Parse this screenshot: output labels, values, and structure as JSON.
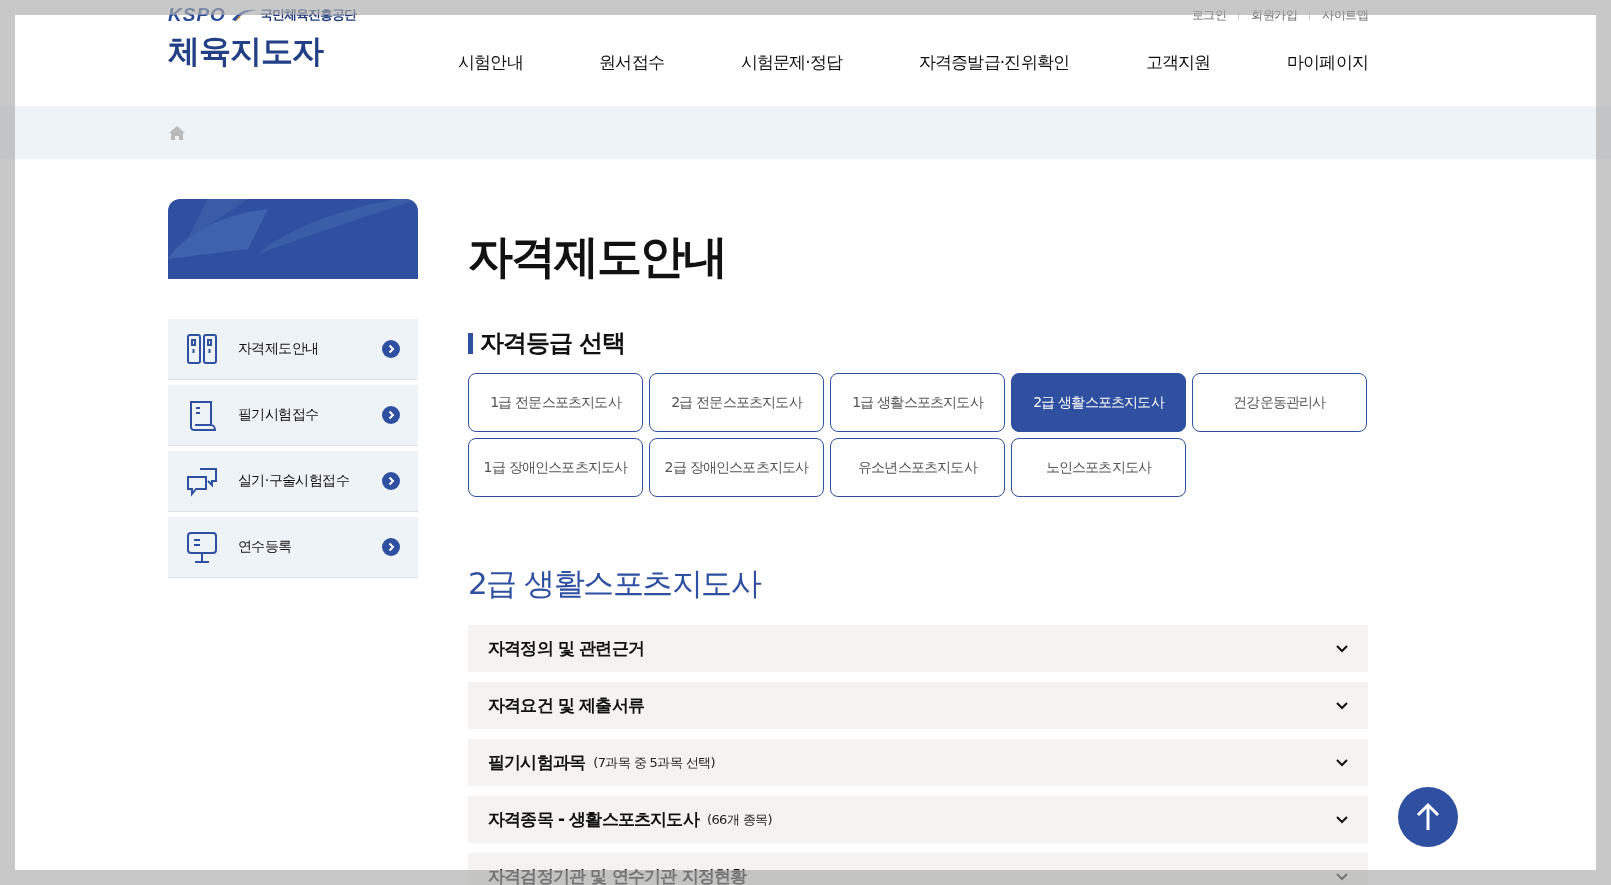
{
  "logo": {
    "org": "국민체육진흥공단",
    "mark": "KSPO",
    "title": "체육지도자"
  },
  "util_links": [
    "로그인",
    "회원가입",
    "사이트맵"
  ],
  "nav": [
    "시험안내",
    "원서접수",
    "시험문제·정답",
    "자격증발급·진위확인",
    "고객지원",
    "마이페이지"
  ],
  "sidebar": {
    "items": [
      {
        "label": "자격제도안내"
      },
      {
        "label": "필기시험접수"
      },
      {
        "label": "실기·구술시험접수"
      },
      {
        "label": "연수등록"
      }
    ]
  },
  "page_title": "자격제도안내",
  "grade_section": {
    "title": "자격등급 선택",
    "grades": [
      {
        "label": "1급 전문스포츠지도사",
        "selected": false
      },
      {
        "label": "2급 전문스포츠지도사",
        "selected": false
      },
      {
        "label": "1급 생활스포츠지도사",
        "selected": false
      },
      {
        "label": "2급 생활스포츠지도사",
        "selected": true
      },
      {
        "label": "건강운동관리사",
        "selected": false
      },
      {
        "label": "1급 장애인스포츠지도사",
        "selected": false
      },
      {
        "label": "2급 장애인스포츠지도사",
        "selected": false
      },
      {
        "label": "유소년스포츠지도사",
        "selected": false
      },
      {
        "label": "노인스포츠지도사",
        "selected": false
      }
    ]
  },
  "grade_heading": "2급 생활스포츠지도사",
  "accordion": [
    {
      "title": "자격정의 및 관련근거",
      "expanded": false
    },
    {
      "title": "자격요건 및 제출서류",
      "expanded": false
    },
    {
      "title": "필기시험과목",
      "note": "(7과목 중 5과목 선택)",
      "expanded": false
    },
    {
      "title": "자격종목 - 생활스포츠지도사",
      "note": "(66개 종목)",
      "expanded": false
    },
    {
      "title": "자격검정기관 및 연수기관 지정현황",
      "expanded": false
    }
  ]
}
